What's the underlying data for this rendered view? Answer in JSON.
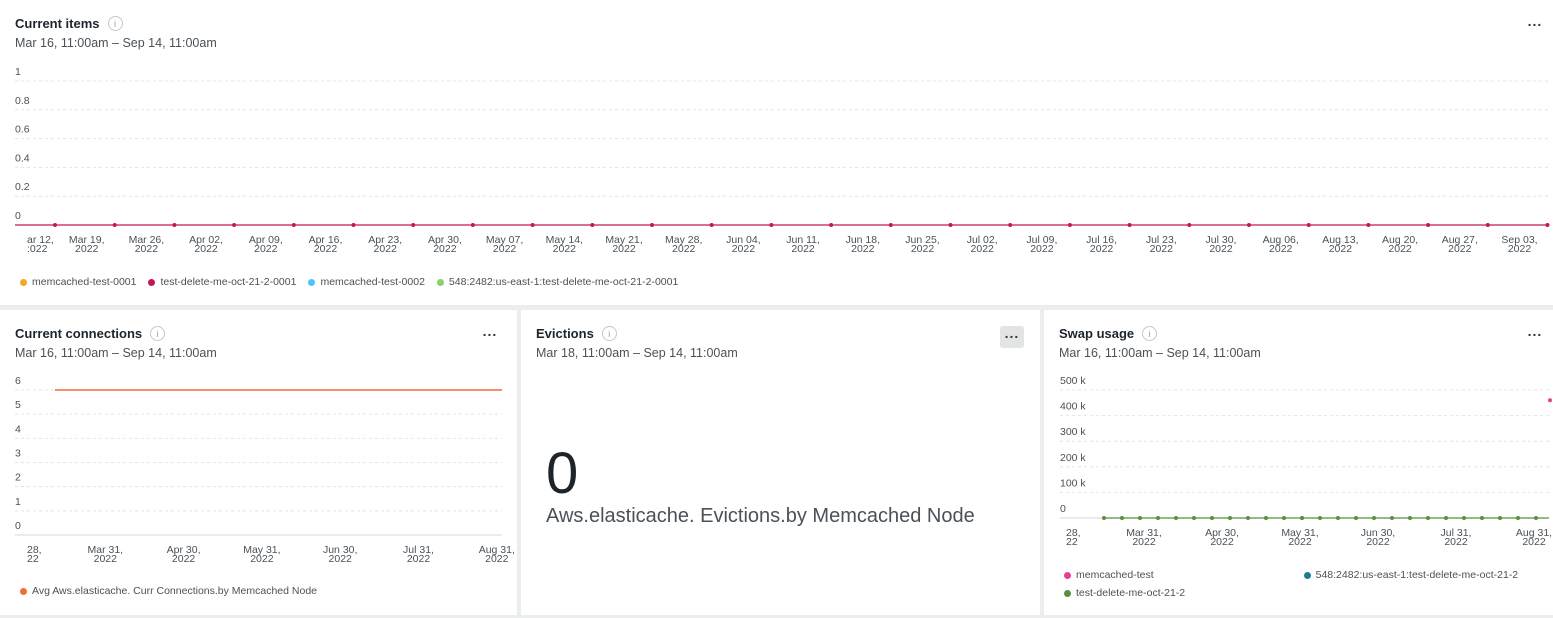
{
  "panels": [
    {
      "title": "Current items",
      "range": "Mar 16, 11:00am – Sep 14, 11:00am",
      "more_label": "...",
      "chart_data": {
        "type": "line",
        "yticks": [
          "1",
          "0.8",
          "0.6",
          "0.4",
          "0.2",
          "0"
        ],
        "ylim": [
          0,
          1
        ],
        "xticks": [
          [
            "ar 12,",
            ":022"
          ],
          [
            "Mar 19,",
            "2022"
          ],
          [
            "Mar 26,",
            "2022"
          ],
          [
            "Apr 02,",
            "2022"
          ],
          [
            "Apr 09,",
            "2022"
          ],
          [
            "Apr 16,",
            "2022"
          ],
          [
            "Apr 23,",
            "2022"
          ],
          [
            "Apr 30,",
            "2022"
          ],
          [
            "May 07,",
            "2022"
          ],
          [
            "May 14,",
            "2022"
          ],
          [
            "May 21,",
            "2022"
          ],
          [
            "May 28,",
            "2022"
          ],
          [
            "Jun 04,",
            "2022"
          ],
          [
            "Jun 11,",
            "2022"
          ],
          [
            "Jun 18,",
            "2022"
          ],
          [
            "Jun 25,",
            "2022"
          ],
          [
            "Jul 02,",
            "2022"
          ],
          [
            "Jul 09,",
            "2022"
          ],
          [
            "Jul 16,",
            "2022"
          ],
          [
            "Jul 23,",
            "2022"
          ],
          [
            "Jul 30,",
            "2022"
          ],
          [
            "Aug 06,",
            "2022"
          ],
          [
            "Aug 13,",
            "2022"
          ],
          [
            "Aug 20,",
            "2022"
          ],
          [
            "Aug 27,",
            "2022"
          ],
          [
            "Sep 03,",
            "2022"
          ]
        ],
        "series": [
          {
            "name": "memcached-test-0001",
            "color": "#f5a623",
            "values": []
          },
          {
            "name": "test-delete-me-oct-21-2-0001",
            "color": "#c2185b",
            "values": [
              0,
              0,
              0,
              0,
              0,
              0,
              0,
              0,
              0,
              0,
              0,
              0,
              0,
              0,
              0,
              0,
              0,
              0,
              0,
              0,
              0,
              0,
              0,
              0,
              0,
              0
            ]
          },
          {
            "name": "memcached-test-0002",
            "color": "#4fc3f7",
            "values": []
          },
          {
            "name": "548:2482:us-east-1:test-delete-me-oct-21-2-0001",
            "color": "#8bd16a",
            "values": []
          }
        ]
      }
    },
    {
      "title": "Current connections",
      "range": "Mar 16, 11:00am – Sep 14, 11:00am",
      "more_label": "...",
      "chart_data": {
        "type": "line",
        "yticks": [
          "6",
          "5",
          "4",
          "3",
          "2",
          "1",
          "0"
        ],
        "ylim": [
          0,
          6
        ],
        "xticks": [
          [
            "28,",
            "22"
          ],
          [
            "Mar 31,",
            "2022"
          ],
          [
            "Apr 30,",
            "2022"
          ],
          [
            "May 31,",
            "2022"
          ],
          [
            "Jun 30,",
            "2022"
          ],
          [
            "Jul 31,",
            "2022"
          ],
          [
            "Aug 31,",
            "2022"
          ]
        ],
        "series": [
          {
            "name": "Avg Aws.elasticache. Curr Connections.by Memcached Node",
            "color": "#f26b3a",
            "values": [
              6,
              6
            ]
          }
        ]
      }
    },
    {
      "title": "Evictions",
      "range": "Mar 18, 11:00am – Sep 14, 11:00am",
      "more_label": "...",
      "value": "0",
      "caption": "Aws.elasticache. Evictions.by Memcached Node"
    },
    {
      "title": "Swap usage",
      "range": "Mar 16, 11:00am – Sep 14, 11:00am",
      "more_label": "...",
      "chart_data": {
        "type": "line",
        "yticks": [
          "500 k",
          "400 k",
          "300 k",
          "200 k",
          "100 k",
          "0"
        ],
        "ylim": [
          0,
          500000
        ],
        "xticks": [
          [
            "28,",
            "22"
          ],
          [
            "Mar 31,",
            "2022"
          ],
          [
            "Apr 30,",
            "2022"
          ],
          [
            "May 31,",
            "2022"
          ],
          [
            "Jun 30,",
            "2022"
          ],
          [
            "Jul 31,",
            "2022"
          ],
          [
            "Aug 31,",
            "2022"
          ]
        ],
        "series": [
          {
            "name": "memcached-test",
            "color": "#e83e8c",
            "values": [
              460000
            ]
          },
          {
            "name": "548:2482:us-east-1:test-delete-me-oct-21-2",
            "color": "#1f7a94",
            "values": [
              0
            ]
          },
          {
            "name": "test-delete-me-oct-21-2",
            "color": "#5b8f3a",
            "values": [
              0,
              0,
              0,
              0,
              0,
              0,
              0,
              0,
              0,
              0,
              0,
              0,
              0,
              0,
              0,
              0,
              0,
              0,
              0,
              0,
              0,
              0,
              0,
              0,
              0
            ]
          }
        ]
      }
    }
  ]
}
